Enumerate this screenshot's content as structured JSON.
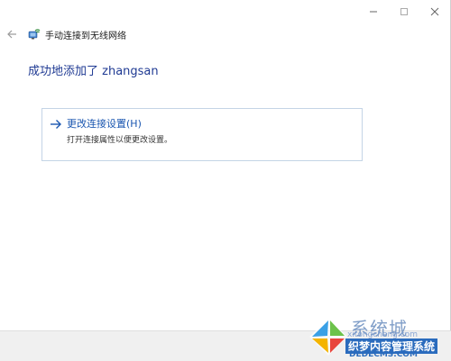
{
  "window": {
    "title": "手动连接到无线网络"
  },
  "main": {
    "title": "成功地添加了 zhangsan",
    "option": {
      "label": "更改连接设置(H)",
      "description": "打开连接属性以便更改设置。"
    }
  },
  "watermark": {
    "brand": "系统城",
    "site_cn": "xitongcheng.com",
    "slogan": "织梦内容管理系统",
    "domain": "DEDECMS.COM"
  },
  "icons": {
    "back": "back-arrow-icon",
    "network": "wireless-network-icon",
    "minimize": "minimize-icon",
    "maximize": "maximize-icon",
    "close": "close-icon",
    "option_arrow": "arrow-right-icon"
  },
  "colors": {
    "title": "#1f3a93",
    "link": "#1a56b0",
    "border": "#c4d4e6"
  }
}
